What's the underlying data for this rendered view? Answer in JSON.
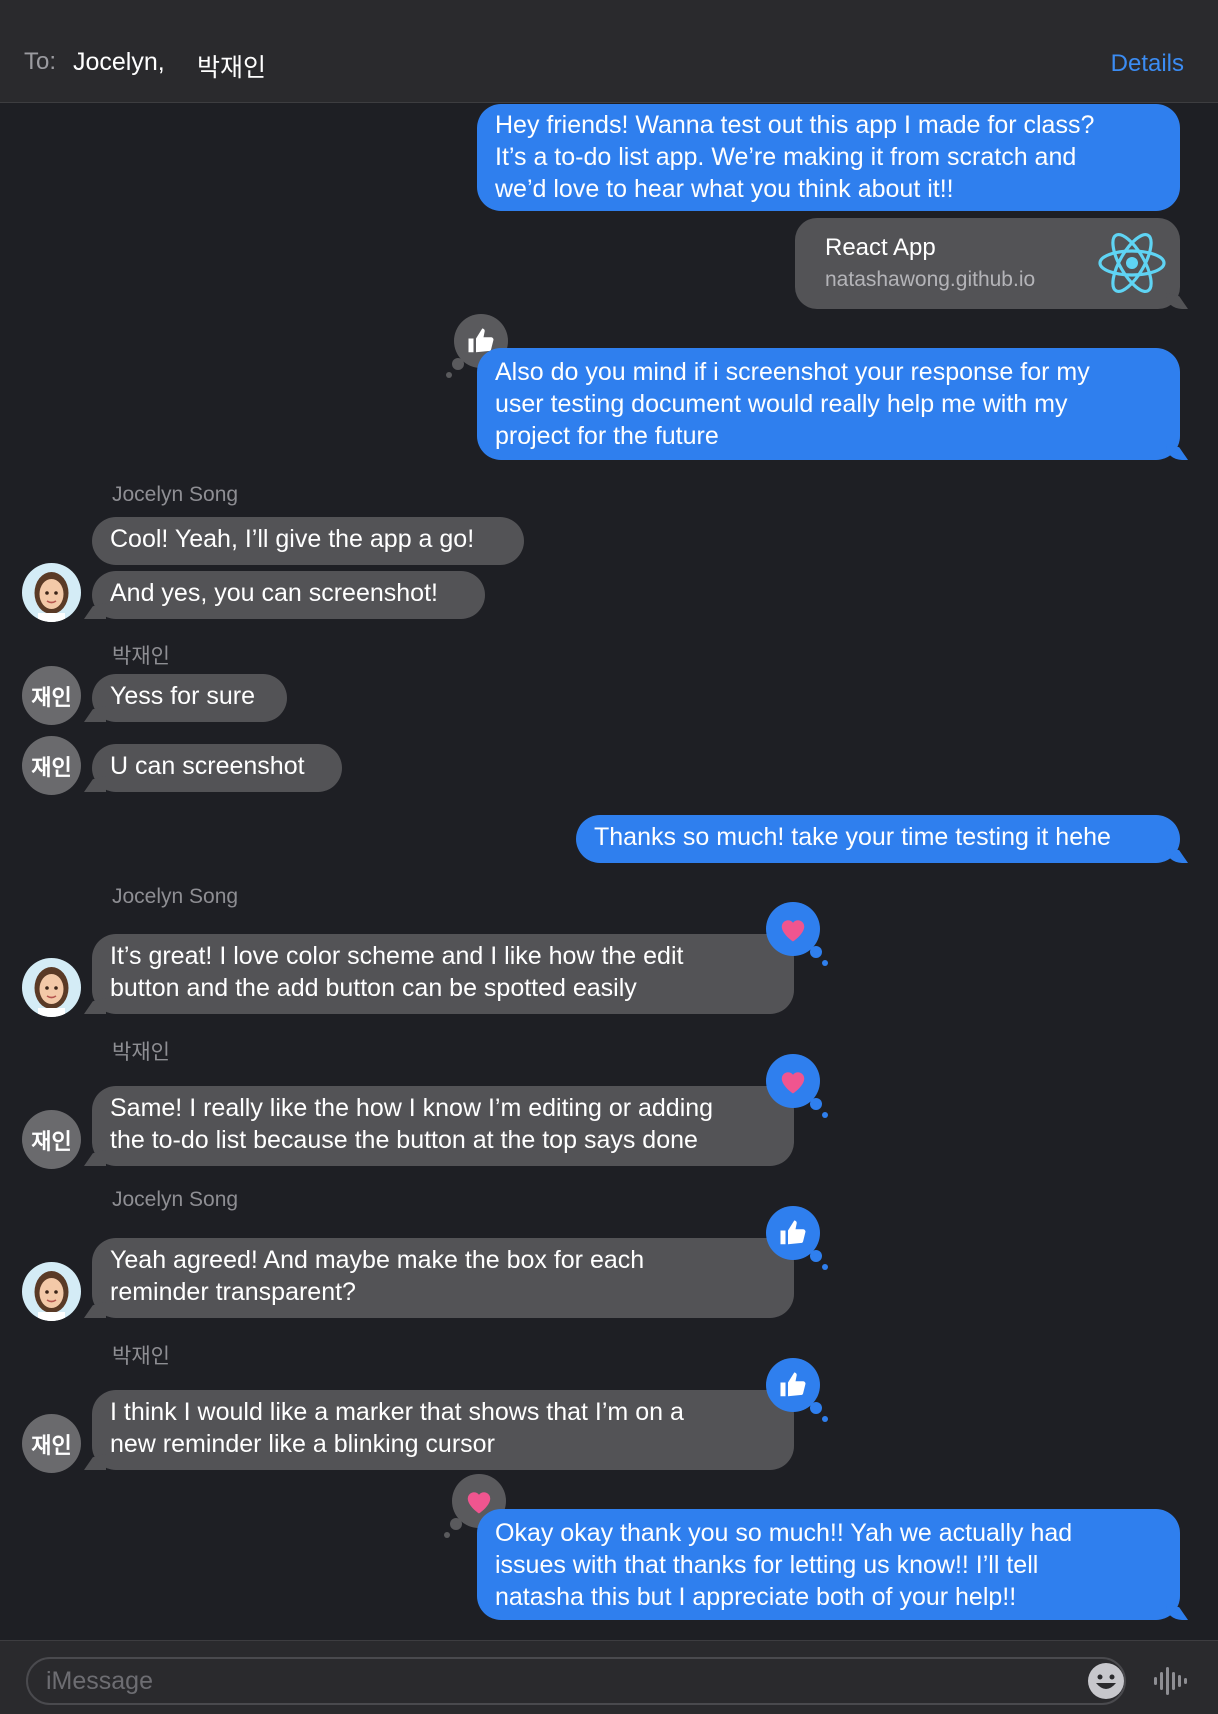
{
  "header": {
    "to_label": "To:",
    "recipients": [
      "Jocelyn,",
      "박재인"
    ],
    "details_label": "Details"
  },
  "link_preview": {
    "title": "React App",
    "domain": "natashawong.github.io",
    "icon": "react-logo-icon"
  },
  "messages": [
    {
      "from": "me",
      "lines": [
        "Hey friends! Wanna test out this app I made for class?",
        "It’s a to-do list app. We’re making it from scratch and",
        "we’d love to hear what you think about it!!"
      ]
    },
    {
      "from": "me",
      "lines": [
        "Also do you mind if i screenshot your response for my",
        "user testing document would really help me with my",
        "project for the future"
      ],
      "tapback": "thumbs-up"
    },
    {
      "from": "Jocelyn Song",
      "lines": [
        "Cool! Yeah, I’ll give the app a go!"
      ]
    },
    {
      "from": "Jocelyn Song",
      "lines": [
        "And yes, you can screenshot!"
      ]
    },
    {
      "from": "박재인",
      "lines": [
        "Yess for sure"
      ]
    },
    {
      "from": "박재인",
      "lines": [
        "U can screenshot"
      ]
    },
    {
      "from": "me",
      "lines": [
        "Thanks so much! take your time testing it hehe"
      ]
    },
    {
      "from": "Jocelyn Song",
      "lines": [
        "It’s great! I love color scheme and I like how the edit",
        "button and the add button can be spotted easily"
      ],
      "tapback": "heart"
    },
    {
      "from": "박재인",
      "lines": [
        "Same! I really like the how I know I’m editing or adding",
        "the to-do list because the button at the top says done"
      ],
      "tapback": "heart"
    },
    {
      "from": "Jocelyn Song",
      "lines": [
        "Yeah agreed! And maybe make the box for each",
        "reminder transparent?"
      ],
      "tapback": "thumbs-up"
    },
    {
      "from": "박재인",
      "lines": [
        "I think I would like a marker that shows that I’m on a",
        "new reminder like a blinking cursor"
      ],
      "tapback": "thumbs-up"
    },
    {
      "from": "me",
      "lines": [
        "Okay okay thank you so much!! Yah we actually had",
        "issues with that thanks for letting us know!! I’ll tell",
        "natasha this but I appreciate both of your help!!"
      ],
      "tapback": "heart"
    }
  ],
  "senders": {
    "jocelyn": "Jocelyn Song",
    "jaein": "박재인",
    "jaein_initials": "재인"
  },
  "composer": {
    "placeholder": "iMessage",
    "emoji_icon": "emoji-icon",
    "audio_icon": "audio-waveform-icon"
  },
  "colors": {
    "outgoing": "#2f7fee",
    "incoming": "#535356",
    "accent": "#3b8cf3",
    "heart": "#f0558f",
    "background": "#1e1f24"
  }
}
